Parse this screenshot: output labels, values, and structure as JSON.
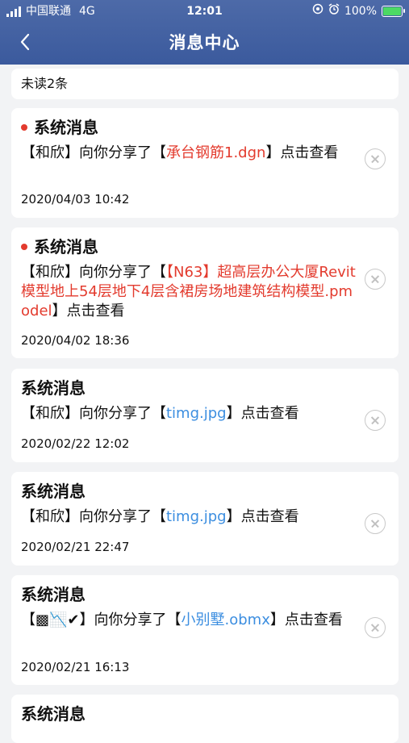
{
  "status_bar": {
    "carrier": "中国联通",
    "network": "4G",
    "time": "12:01",
    "battery": "100%"
  },
  "header": {
    "title": "消息中心"
  },
  "unread": {
    "text": "未读2条"
  },
  "messages": [
    {
      "title": "系统消息",
      "unread": true,
      "prefix": "【和欣】向你分享了【",
      "file": "承台钢筋1.dgn",
      "file_color": "red",
      "suffix": "】点击查看",
      "time": "2020/04/03 10:42"
    },
    {
      "title": "系统消息",
      "unread": true,
      "prefix": "【和欣】向你分享了【",
      "file": "【N63】超高层办公大厦Revit模型地上54层地下4层含裙房场地建筑结构模型.pmodel",
      "file_color": "red",
      "suffix": "】点击查看",
      "time": "2020/04/02 18:36"
    },
    {
      "title": "系统消息",
      "unread": false,
      "prefix": "【和欣】向你分享了【",
      "file": "timg.jpg",
      "file_color": "blue",
      "suffix": "】点击查看",
      "time": "2020/02/22 12:02"
    },
    {
      "title": "系统消息",
      "unread": false,
      "prefix": "【和欣】向你分享了【",
      "file": "timg.jpg",
      "file_color": "blue",
      "suffix": "】点击查看",
      "time": "2020/02/21 22:47"
    },
    {
      "title": "系统消息",
      "unread": false,
      "prefix": "【▩📉✔】向你分享了【",
      "file": "小别墅.obmx",
      "file_color": "blue",
      "suffix": "】点击查看",
      "time": "2020/02/21 16:13"
    },
    {
      "title": "系统消息",
      "unread": false
    }
  ],
  "colors": {
    "header": "#3b5a9d",
    "unread_dot": "#e33b2e",
    "link_red": "#e33b2e",
    "link_blue": "#3c8ee0"
  },
  "icons": {
    "back": "chevron-left-icon",
    "close": "close-circle-icon"
  }
}
